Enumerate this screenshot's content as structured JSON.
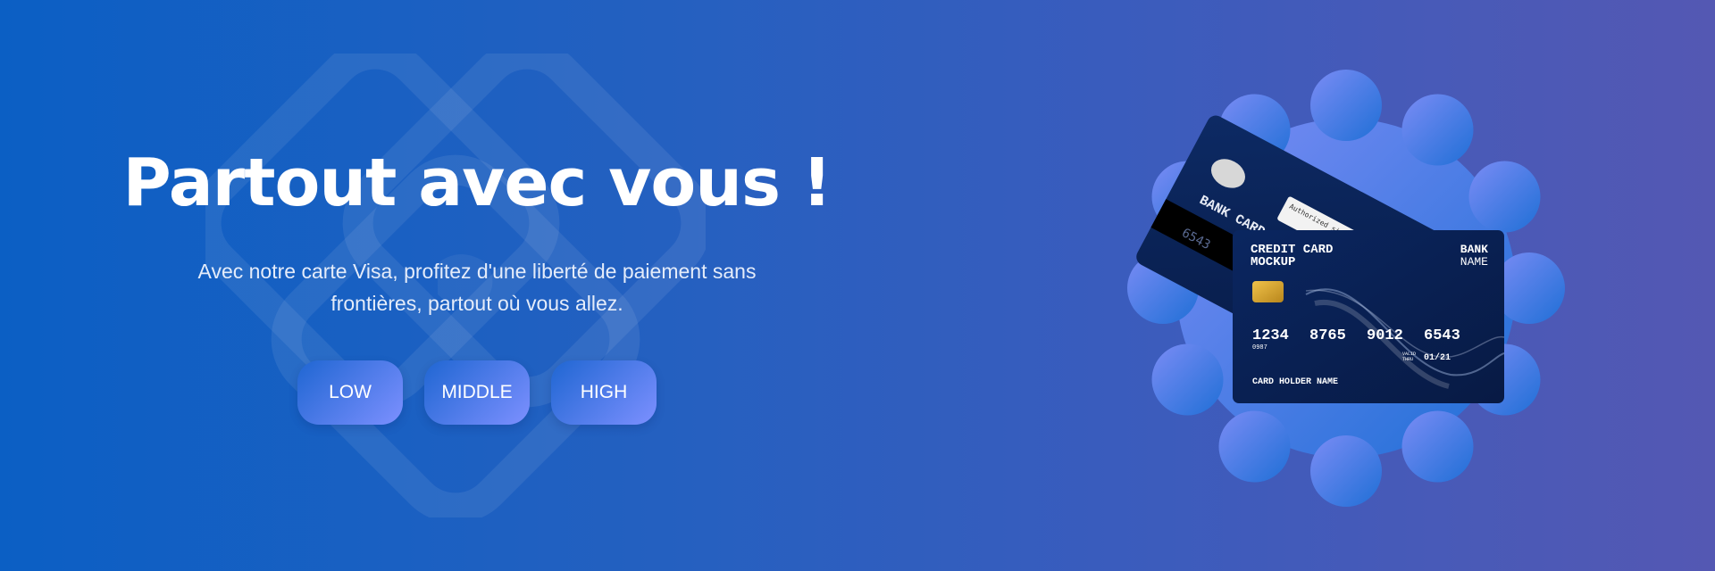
{
  "hero": {
    "title": "Partout avec vous !",
    "subtitle": "Avec notre carte Visa, profitez d'une liberté de paiement sans frontières, partout où vous allez.",
    "buttons": [
      {
        "label": "LOW"
      },
      {
        "label": "MIDDLE"
      },
      {
        "label": "HIGH"
      }
    ]
  },
  "card_front": {
    "title_line1": "CREDIT CARD",
    "title_line2": "MOCKUP",
    "bank_line1": "BANK",
    "bank_line2": "NAME",
    "number_groups": [
      "1234",
      "8765",
      "9012",
      "6543"
    ],
    "small_code": "0987",
    "valid_label_1": "VALID",
    "valid_label_2": "THRU",
    "expiry": "01/21",
    "holder": "CARD HOLDER NAME"
  },
  "card_back": {
    "title": "BANK CARD MOCKUP",
    "signature_label": "Authorized signature",
    "cvv": "6543"
  },
  "colors": {
    "background_start": "#0b5fc4",
    "background_end": "#5458b3",
    "badge_start": "#7b8cf5",
    "badge_end": "#1f6fd6",
    "button_start": "#1f66d2",
    "button_end": "#7d90ff",
    "card_dark": "#0a1f4e"
  }
}
